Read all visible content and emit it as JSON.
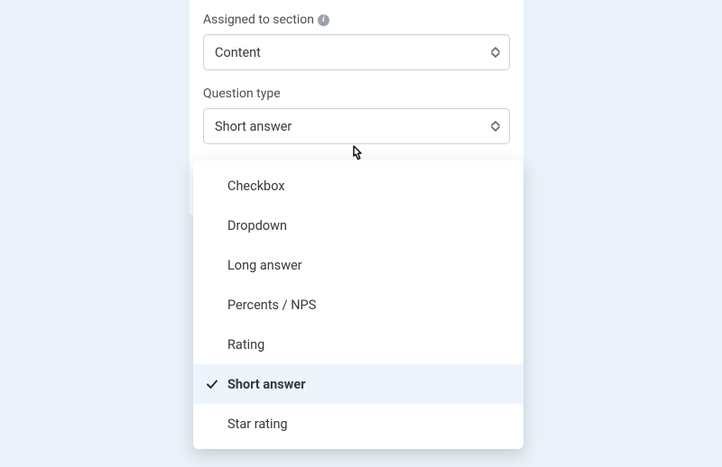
{
  "assigned_section": {
    "label": "Assigned to section",
    "info_icon_name": "info-icon",
    "value": "Content"
  },
  "question_type": {
    "label": "Question type",
    "value": "Short answer",
    "options": [
      {
        "label": "Checkbox",
        "selected": false
      },
      {
        "label": "Dropdown",
        "selected": false
      },
      {
        "label": "Long answer",
        "selected": false
      },
      {
        "label": "Percents / NPS",
        "selected": false
      },
      {
        "label": "Rating",
        "selected": false
      },
      {
        "label": "Short answer",
        "selected": true
      },
      {
        "label": "Star rating",
        "selected": false
      }
    ]
  }
}
